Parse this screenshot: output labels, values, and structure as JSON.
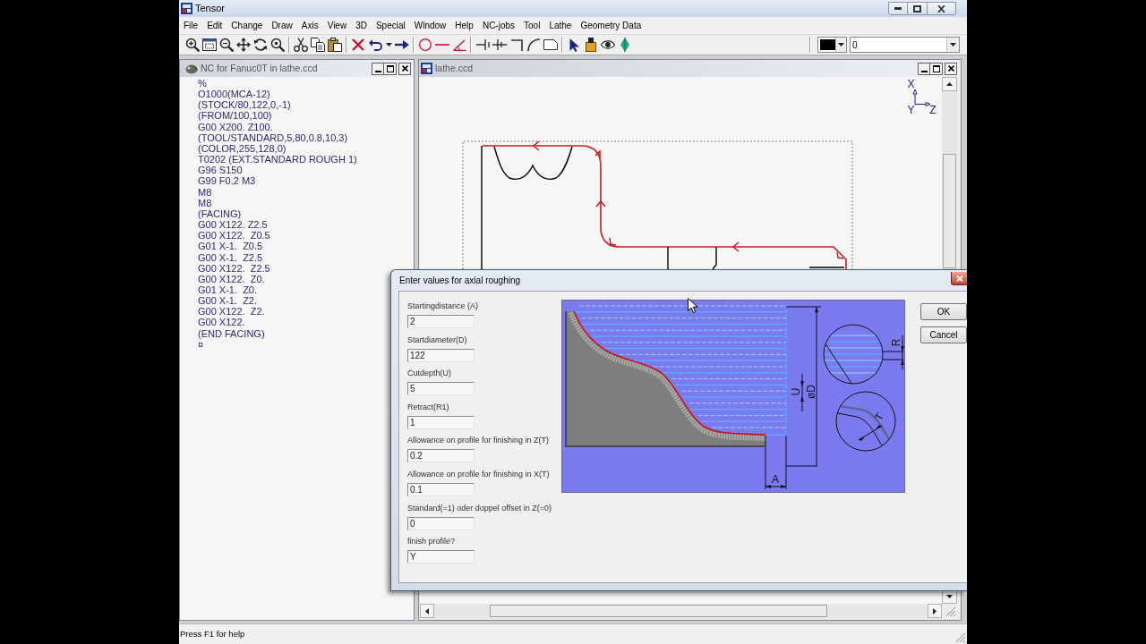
{
  "window": {
    "title": "Tensor"
  },
  "menu": [
    "File",
    "Edit",
    "Change",
    "Draw",
    "Axis",
    "View",
    "3D",
    "Special",
    "Window",
    "Help",
    "NC-jobs",
    "Tool",
    "Lathe",
    "Geometry Data"
  ],
  "toolbar": {
    "color": "#000000",
    "layer": "0"
  },
  "nc_window": {
    "title": "NC for Fanuc0T in lathe.ccd",
    "lines": [
      "%",
      "O1000(MCA-12)",
      "(STOCK/80,122,0,-1)",
      "(FROM/100,100)",
      "G00 X200. Z100.",
      "(TOOL/STANDARD,5,80,0.8,10,3)",
      "(COLOR,255,128,0)",
      "T0202 (EXT.STANDARD ROUGH 1)",
      "G96 S150",
      "G99 F0.2 M3",
      "M8",
      "M8",
      "(FACING)",
      "G00 X122. Z2.5",
      "G00 X122.  Z0.5",
      "G01 X-1.  Z0.5",
      "G00 X-1.  Z2.5",
      "G00 X122.  Z2.5",
      "G00 X122.  Z0.",
      "G01 X-1.  Z0.",
      "G00 X-1.  Z2.",
      "G00 X122.  Z2.",
      "G00 X122.",
      "(END FACING)",
      "¤"
    ]
  },
  "drawing_window": {
    "title": "lathe.ccd",
    "axes": [
      "X",
      "Y",
      "Z"
    ]
  },
  "dialog": {
    "title": "Enter values for axial roughing",
    "fields": [
      {
        "label": "Startingdistance (A)",
        "value": "2"
      },
      {
        "label": "Startdiameter(D)",
        "value": "122"
      },
      {
        "label": "Cutdepth(U)",
        "value": "5"
      },
      {
        "label": "Retract(R1)",
        "value": "1"
      },
      {
        "label": "Allowance on profile for finishing in Z(T)",
        "value": "0.2"
      },
      {
        "label": "Allowance on profile for finishing in X(T)",
        "value": "0.1"
      },
      {
        "label": "Standard(=1) oder doppel offset in Z(=0)",
        "value": "0"
      },
      {
        "label": "finish profile?",
        "value": "Y"
      }
    ],
    "diagram_labels": [
      "U",
      "øD",
      "R",
      "T",
      "A"
    ],
    "buttons": [
      "OK",
      "Cancel"
    ]
  },
  "status_bar": {
    "text": "Press F1 for help"
  }
}
